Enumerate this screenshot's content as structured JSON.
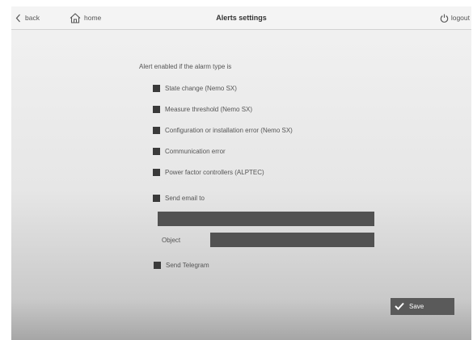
{
  "topbar": {
    "back_label": "back",
    "home_label": "home",
    "title": "Alerts settings",
    "logout_label": "logout"
  },
  "form": {
    "intro": "Alert enabled if the alarm type is",
    "options": [
      {
        "label": "State change (Nemo SX)",
        "checked": true
      },
      {
        "label": "Measure threshold (Nemo SX)",
        "checked": true
      },
      {
        "label": "Configuration or installation error (Nemo SX)",
        "checked": true
      },
      {
        "label": "Communication error",
        "checked": true
      },
      {
        "label": "Power factor controllers (ALPTEC)",
        "checked": true
      }
    ],
    "send_email_label": "Send email to",
    "email_value": "",
    "object_label": "Object",
    "object_value": "",
    "send_telegram_label": "Send Telegram"
  },
  "actions": {
    "save_label": "Save"
  },
  "icons": {
    "back": "chevron-left-icon",
    "home": "home-icon",
    "logout": "power-icon",
    "save": "checkmark-icon"
  },
  "colors": {
    "checkbox": "#3a3a3a",
    "input": "#525252",
    "save_button": "#5a5a5a"
  }
}
